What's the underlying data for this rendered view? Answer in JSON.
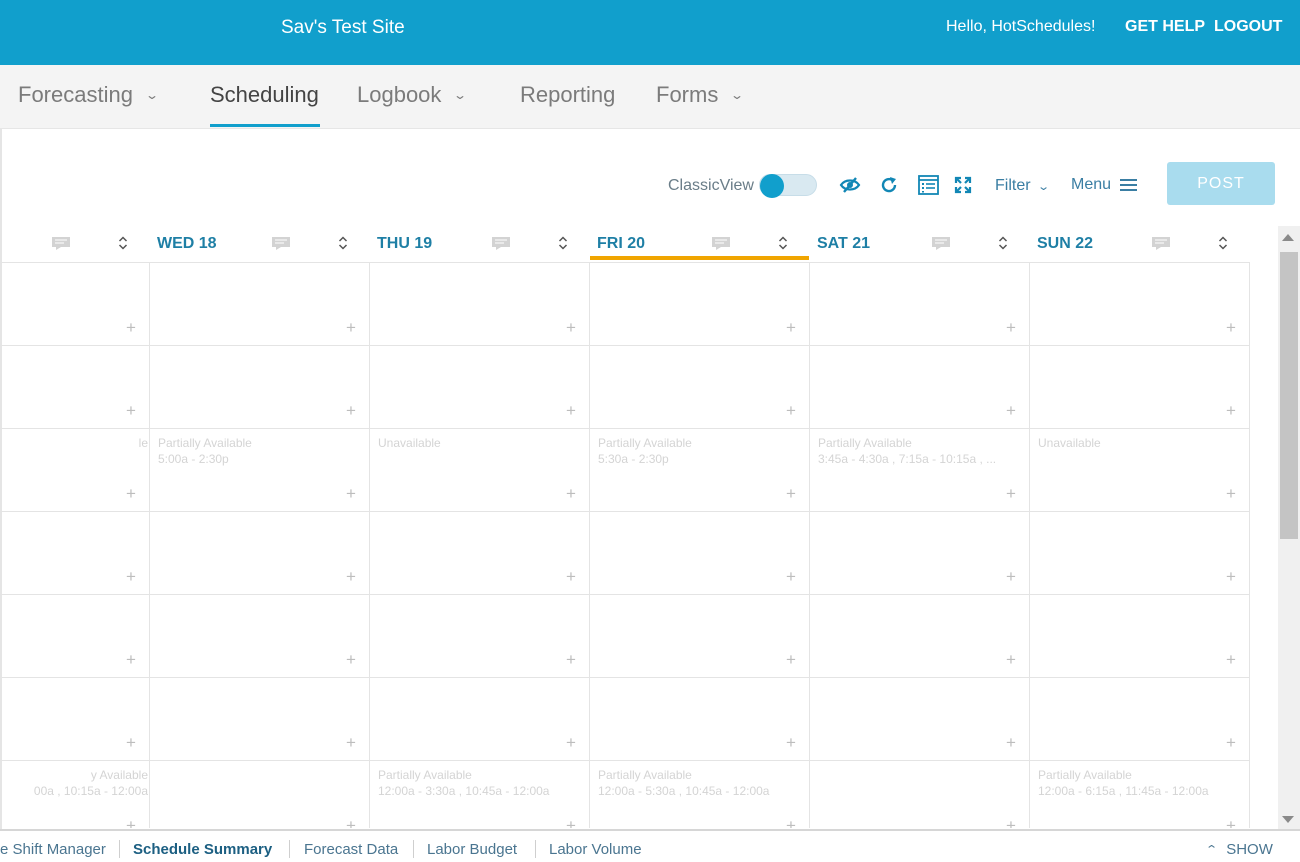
{
  "header": {
    "site_title": "Sav's Test Site",
    "greeting": "Hello, HotSchedules!",
    "get_help": "GET HELP",
    "logout": "LOGOUT"
  },
  "nav": {
    "items": [
      {
        "label": "Forecasting",
        "dropdown": true
      },
      {
        "label": "Scheduling",
        "active": true
      },
      {
        "label": "Logbook",
        "dropdown": true
      },
      {
        "label": "Reporting"
      },
      {
        "label": "Forms",
        "dropdown": true
      }
    ]
  },
  "toolbar": {
    "classic_view_label": "ClassicView",
    "classic_view_on": false,
    "filter_label": "Filter",
    "menu_label": "Menu",
    "post_label": "POST",
    "icons": [
      "hide-icon",
      "refresh-icon",
      "list-view-icon",
      "expand-icon"
    ]
  },
  "days": [
    {
      "label": ""
    },
    {
      "label": "WED 18"
    },
    {
      "label": "THU 19"
    },
    {
      "label": "FRI 20",
      "today": true
    },
    {
      "label": "SAT 21"
    },
    {
      "label": "SUN 22"
    }
  ],
  "availability": {
    "r2c0": {
      "status": "le",
      "times": ""
    },
    "r2c1": {
      "status": "Partially Available",
      "times": "5:00a - 2:30p"
    },
    "r2c2": {
      "status": "Unavailable",
      "times": ""
    },
    "r2c3": {
      "status": "Partially Available",
      "times": "5:30a - 2:30p"
    },
    "r2c4": {
      "status": "Partially Available",
      "times": "3:45a - 4:30a , 7:15a - 10:15a , ..."
    },
    "r2c5": {
      "status": "Unavailable",
      "times": ""
    },
    "r6c0": {
      "status": "y Available",
      "times": "00a , 10:15a - 12:00a"
    },
    "r6c2": {
      "status": "Partially Available",
      "times": "12:00a - 3:30a , 10:45a - 12:00a"
    },
    "r6c3": {
      "status": "Partially Available",
      "times": "12:00a - 5:30a , 10:45a - 12:00a"
    },
    "r6c5": {
      "status": "Partially Available",
      "times": "12:00a - 6:15a , 11:45a - 12:00a"
    }
  },
  "footer": {
    "tabs": [
      {
        "label": "e Shift Manager"
      },
      {
        "label": "Schedule Summary",
        "active": true
      },
      {
        "label": "Forecast Data"
      },
      {
        "label": "Labor Budget"
      },
      {
        "label": "Labor Volume"
      }
    ],
    "show_label": "SHOW"
  },
  "colors": {
    "brand": "#119fcc",
    "today_marker": "#f0a500",
    "day_label": "#1e7fa5",
    "post_disabled": "#a9dcee"
  }
}
